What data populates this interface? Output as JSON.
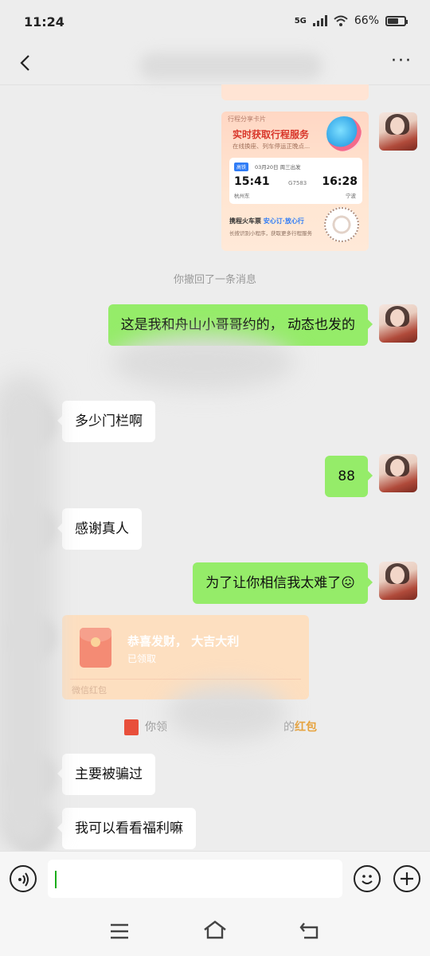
{
  "status_bar": {
    "time": "11:24",
    "network": "5G",
    "battery": "66%"
  },
  "header": {
    "more_label": "···"
  },
  "messages": {
    "share_card": {
      "tag": "行程分享卡片",
      "title": "实时获取行程服务",
      "subtitle": "在线换座、列车停运正晚点...",
      "badge": "高铁",
      "date": "03月20日  周三出发",
      "depart_time": "15:41",
      "arrive_time": "16:28",
      "train_no": "G7583",
      "from_station": "杭州东",
      "to_station": "宁波",
      "brand": "携程火车票",
      "slogan": "安心订·放心行",
      "desc": "长按识别小程序，获取更多行程服务"
    },
    "recall_notice": "你撤回了一条消息",
    "m1": "这是我和舟山小哥哥约的， 动态也发的",
    "m2": "多少门栏啊",
    "m3": "88",
    "m4": "感谢真人",
    "m5": "为了让你相信我太难了😖",
    "red_packet": {
      "title": "恭喜发财， 大吉大利",
      "status": "已领取",
      "footer": "微信红包"
    },
    "red_packet_notice_prefix": "你领",
    "red_packet_notice_suffix": "的",
    "red_packet_notice_link": "红包",
    "m6": "主要被骗过",
    "m7": "我可以看看福利嘛"
  },
  "input": {
    "value": ""
  }
}
